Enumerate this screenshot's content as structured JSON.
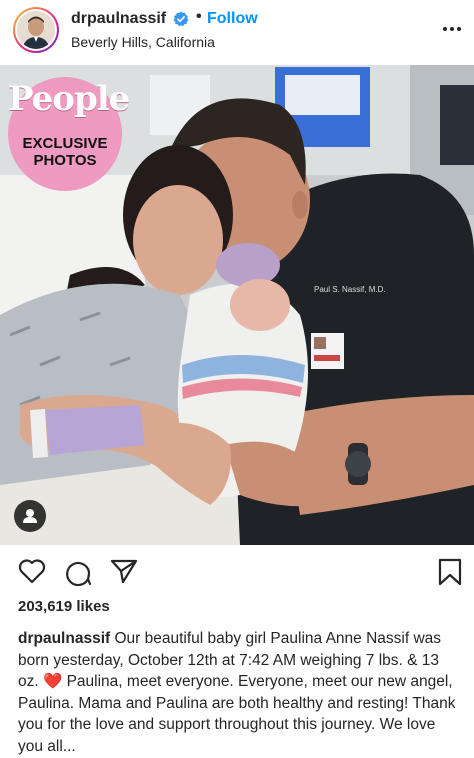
{
  "post": {
    "username": "drpaulnassif",
    "follow_label": "Follow",
    "dot": "•",
    "location": "Beverly Hills, California",
    "badge": {
      "brand": "People",
      "line1": "EXCLUSIVE",
      "line2": "PHOTOS"
    },
    "scrubs_text": "Paul S. Nassif, M.D.",
    "likes": "203,619 likes",
    "caption_text": "Our beautiful baby girl Paulina Anne Nassif was born yesterday, October 12th at 7:42 AM weighing 7 lbs. & 13 oz. ❤️ Paulina, meet everyone. Everyone, meet our new angel, Paulina. Mama and Paulina are both healthy and resting! Thank you for the love and support throughout this journey. We love you all...",
    "colors": {
      "follow": "#0095f6",
      "verified": "#3897f0",
      "badge_pink": "#ef9ac0",
      "text": "#262626"
    },
    "icons": [
      "verified-icon",
      "more-options-icon",
      "user-tag-icon",
      "heart-icon",
      "comment-icon",
      "share-icon",
      "bookmark-icon"
    ]
  }
}
